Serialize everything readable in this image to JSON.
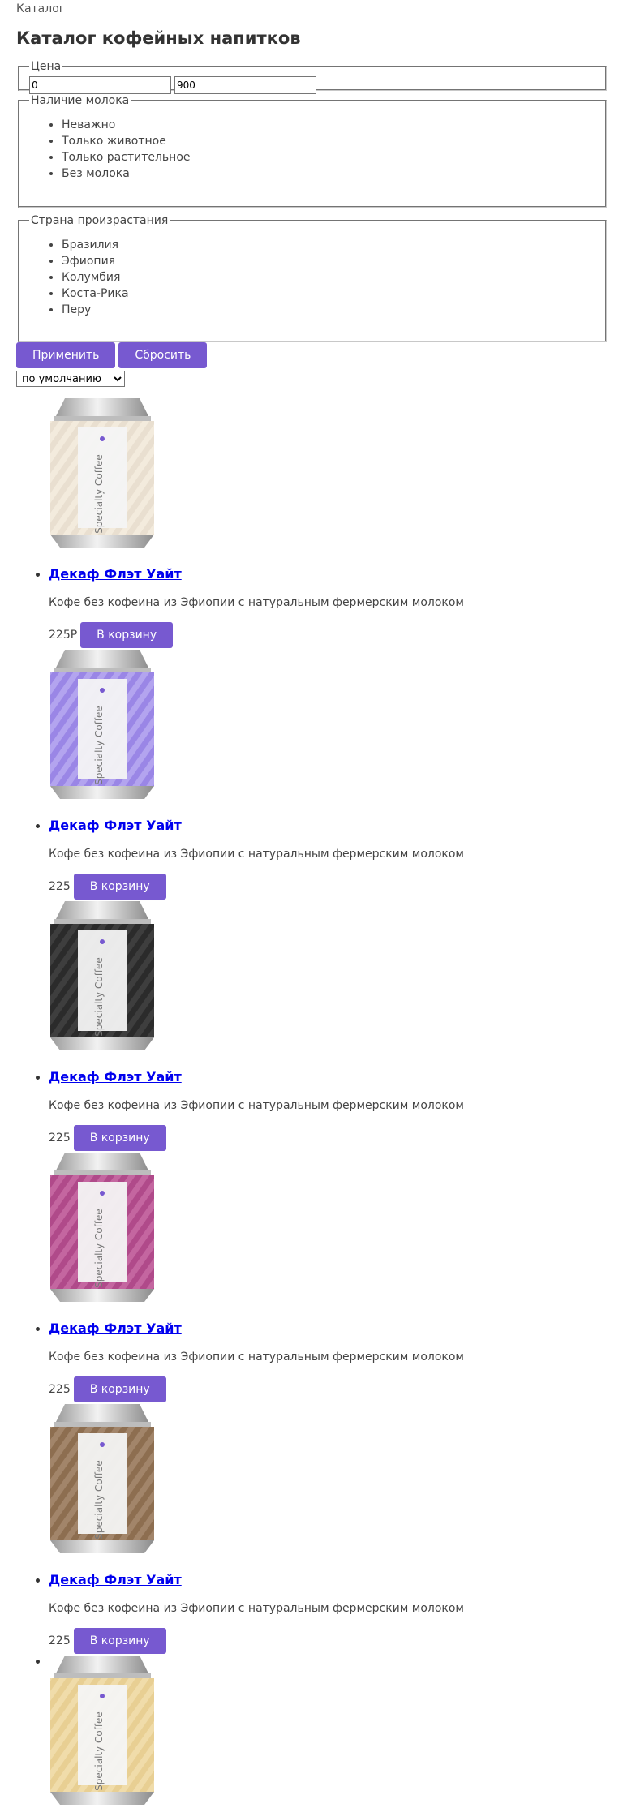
{
  "breadcrumb": "Каталог",
  "page_title": "Каталог кофейных напитков",
  "filters": {
    "price": {
      "legend": "Цена",
      "min_value": "0",
      "max_value": "900"
    },
    "milk": {
      "legend": "Наличие молока",
      "options": [
        "Неважно",
        "Только животное",
        "Только растительное",
        "Без молока"
      ]
    },
    "country": {
      "legend": "Страна произрастания",
      "options": [
        "Бразилия",
        "Эфиопия",
        "Колумбия",
        "Коста-Рика",
        "Перу"
      ]
    },
    "apply_label": "Применить",
    "reset_label": "Сбросить"
  },
  "sort": {
    "selected": "по умолчанию"
  },
  "products": [
    {
      "name": "Декаф Флэт Уайт",
      "description": "Кофе без кофеина из Эфиопии с натуральным фермерским молоком",
      "price": "225Р",
      "cart_label": "В корзину",
      "can_color": "#e9dfd0",
      "stripe_color": "#f3ebdd"
    },
    {
      "name": "Декаф Флэт Уайт",
      "description": "Кофе без кофеина из Эфиопии с натуральным фермерским молоком",
      "price": "225",
      "cart_label": "В корзину",
      "can_color": "#9a86e6",
      "stripe_color": "#b3a4ef"
    },
    {
      "name": "Декаф Флэт Уайт",
      "description": "Кофе без кофеина из Эфиопии с натуральным фермерским молоком",
      "price": "225",
      "cart_label": "В корзину",
      "can_color": "#2b2b2b",
      "stripe_color": "#3e3e3e"
    },
    {
      "name": "Декаф Флэт Уайт",
      "description": "Кофе без кофеина из Эфиопии с натуральным фермерским молоком",
      "price": "225",
      "cart_label": "В корзину",
      "can_color": "#b04a8a",
      "stripe_color": "#c466a0"
    },
    {
      "name": "Декаф Флэт Уайт",
      "description": "Кофе без кофеина из Эфиопии с натуральным фермерским молоком",
      "price": "225",
      "cart_label": "В корзину",
      "can_color": "#8d6e50",
      "stripe_color": "#a2856a"
    },
    {
      "name": "",
      "description": "",
      "price": "",
      "cart_label": "",
      "can_color": "#e8cf93",
      "stripe_color": "#f0dcaa"
    }
  ],
  "can_label": "Specialty Coffee",
  "colors": {
    "accent": "#7759d0",
    "link": "#0000ee"
  }
}
